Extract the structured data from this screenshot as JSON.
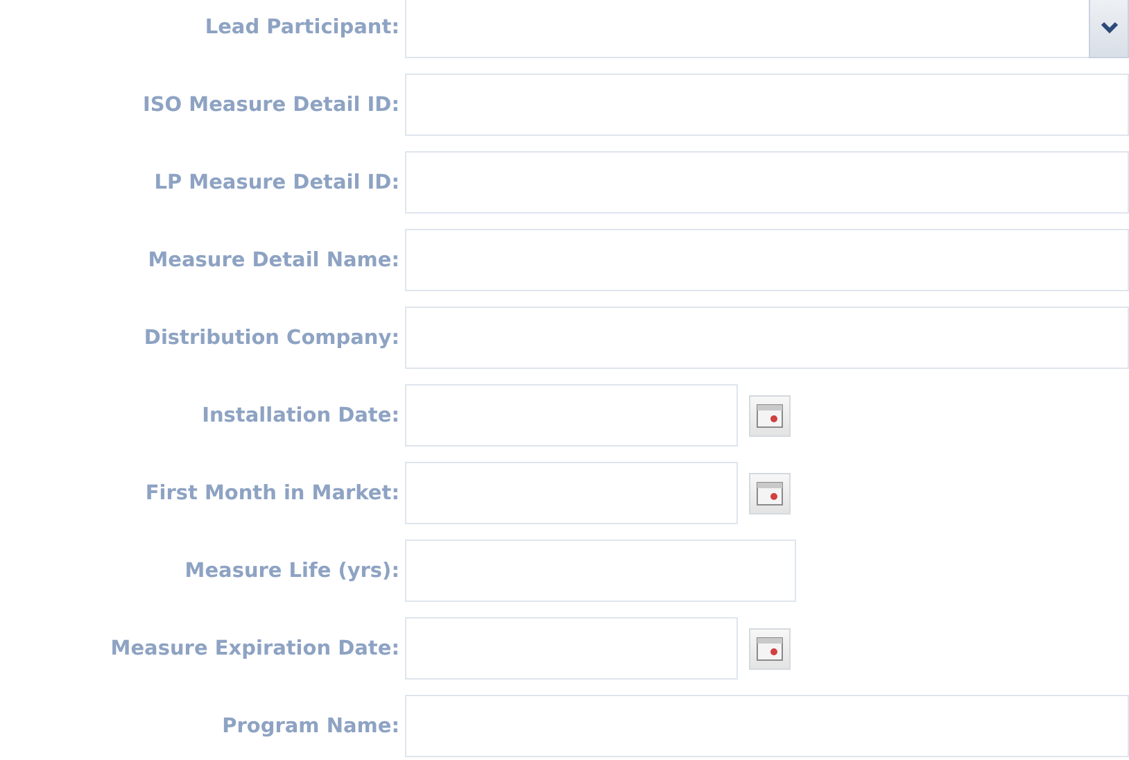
{
  "fields": [
    {
      "label": "Lead Participant:",
      "kind": "dropdown"
    },
    {
      "label": "ISO Measure Detail ID:",
      "kind": "text"
    },
    {
      "label": "LP Measure Detail ID:",
      "kind": "text"
    },
    {
      "label": "Measure Detail Name:",
      "kind": "text"
    },
    {
      "label": "Distribution Company:",
      "kind": "text"
    },
    {
      "label": "Installation Date:",
      "kind": "date"
    },
    {
      "label": "First Month in Market:",
      "kind": "date"
    },
    {
      "label": "Measure Life (yrs):",
      "kind": "short"
    },
    {
      "label": "Measure Expiration Date:",
      "kind": "date"
    },
    {
      "label": "Program Name:",
      "kind": "text"
    }
  ]
}
